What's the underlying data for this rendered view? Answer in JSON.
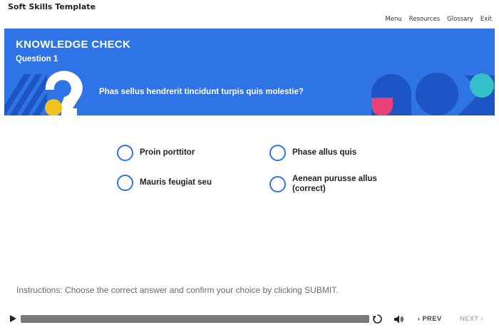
{
  "app": {
    "title": "Soft Skills Template"
  },
  "top_nav": {
    "items": [
      "Menu",
      "Resources",
      "Glossary",
      "Exit"
    ]
  },
  "banner": {
    "heading": "KNOWLEDGE CHECK",
    "subheading": "Question 1",
    "question": "Phas sellus hendrerit tincidunt turpis quis molestie?",
    "colors": {
      "background": "#2e74e6",
      "yellow": "#f4c21f",
      "pink": "#e8407a",
      "teal": "#34c0c8",
      "dark_blue": "#1e55c4"
    }
  },
  "options": [
    {
      "label": "Proin porttitor",
      "selected": false
    },
    {
      "label": "Phase allus quis",
      "selected": false
    },
    {
      "label": "Mauris feugiat seu",
      "selected": false
    },
    {
      "label": "Aenean purusse allus (correct)",
      "selected": false
    }
  ],
  "instructions": "Instructions: Choose the correct answer and confirm your choice by clicking SUBMIT.",
  "player": {
    "prev_label": "‹ PREV",
    "next_label": "NEXT ›",
    "icons": [
      "play-icon",
      "replay-icon",
      "volume-icon"
    ]
  }
}
